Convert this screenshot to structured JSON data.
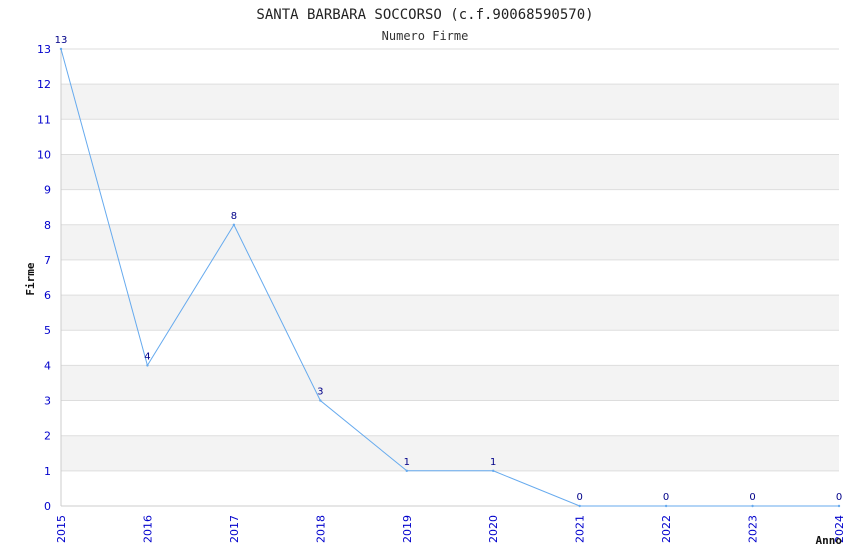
{
  "chart_data": {
    "type": "line",
    "title": "SANTA BARBARA SOCCORSO (c.f.90068590570)",
    "subtitle": "Numero Firme",
    "xlabel": "Anno",
    "ylabel": "Firme",
    "categories": [
      "2015",
      "2016",
      "2017",
      "2018",
      "2019",
      "2020",
      "2021",
      "2022",
      "2023",
      "2024"
    ],
    "series": [
      {
        "values": [
          13,
          4,
          8,
          3,
          1,
          1,
          0,
          0,
          0,
          0
        ]
      }
    ],
    "ylim": [
      0,
      13
    ],
    "yticks": [
      "0",
      "1",
      "2",
      "3",
      "4",
      "5",
      "6",
      "7",
      "8",
      "9",
      "10",
      "11",
      "12",
      "13"
    ],
    "grid": true,
    "band_colors": [
      "#ffffff",
      "#f3f3f3"
    ],
    "line_color": "#66aaee",
    "tick_color": "#0000cc",
    "label_color": "#000088"
  }
}
